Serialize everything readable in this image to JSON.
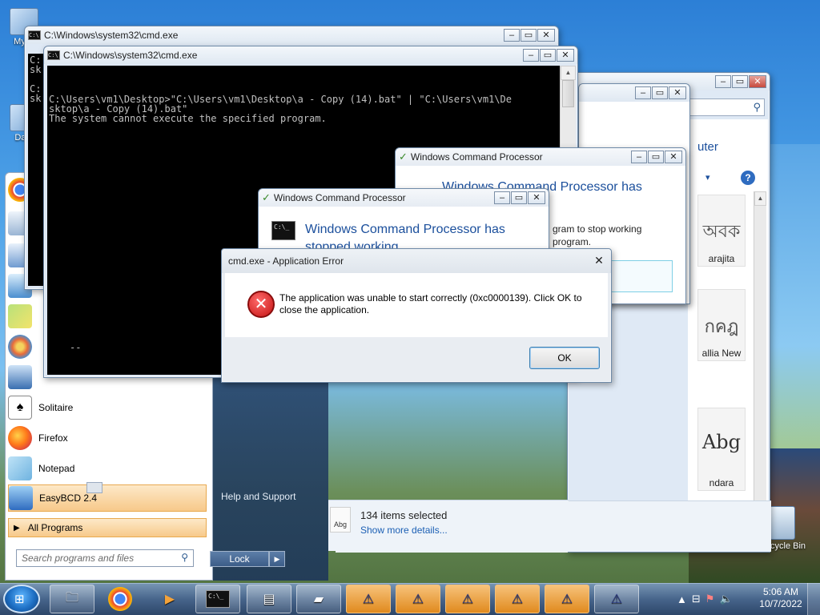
{
  "desktop": {
    "icons": [
      {
        "label": "My C",
        "icon": "computer-icon"
      },
      {
        "label": "Data",
        "icon": "data-icon"
      }
    ],
    "recycle_bin": {
      "label": "Recycle Bin"
    }
  },
  "cmd_back": {
    "title": "C:\\Windows\\system32\\cmd.exe",
    "lines": [
      "C:",
      "sk",
      "",
      "C:",
      "sk"
    ]
  },
  "cmd_front": {
    "title": "C:\\Windows\\system32\\cmd.exe",
    "output": "C:\\Users\\vm1\\Desktop>\"C:\\Users\\vm1\\Desktop\\a - Copy (14).bat\" | \"C:\\Users\\vm1\\De\nsktop\\a - Copy (14).bat\"\nThe system cannot execute the specified program.",
    "cursor": "--"
  },
  "explorer": {
    "partial_title": "uter",
    "status": {
      "selected": "134 items selected",
      "details_link": "Show more details..."
    },
    "tiles": [
      {
        "glyph": "অবক",
        "label": "arajita"
      },
      {
        "glyph": "กคฎ",
        "label": "allia New"
      },
      {
        "glyph": "Abg",
        "label": "ndara"
      }
    ],
    "status_icon_label": "Abg"
  },
  "wcp_back": {
    "title": "Windows Command Processor",
    "heading": "Windows Command Processor has",
    "body_lines": [
      "gram to stop working",
      "program."
    ]
  },
  "wcp_front": {
    "title": "Windows Command Processor",
    "heading": "Windows Command Processor has stopped working"
  },
  "error_dialog": {
    "title": "cmd.exe - Application Error",
    "message": "The application was unable to start correctly (0xc0000139). Click OK to close the application.",
    "ok_label": "OK"
  },
  "start_menu": {
    "items": [
      {
        "label": "",
        "icon": "chrome-icon"
      },
      {
        "label": "",
        "icon": "app-icon"
      },
      {
        "label": "",
        "icon": "app-icon"
      },
      {
        "label": "",
        "icon": "app-icon"
      },
      {
        "label": "",
        "icon": "paint-icon"
      },
      {
        "label": "",
        "icon": "computer-icon"
      },
      {
        "label": "Solitaire",
        "icon": "solitaire-icon"
      },
      {
        "label": "Firefox",
        "icon": "firefox-icon"
      },
      {
        "label": "Notepad",
        "icon": "notepad-icon"
      },
      {
        "label": "EasyBCD 2.4",
        "icon": "easybcd-icon"
      }
    ],
    "all_programs": "All Programs",
    "search_placeholder": "Search programs and files",
    "right_text": "Help and Support",
    "lock": "Lock"
  },
  "taskbar": {
    "clock_time": "5:06 AM",
    "clock_date": "10/7/2022"
  },
  "colors": {
    "accent_title": "#1b4f9c",
    "taskbar_warn": "#e08a1e",
    "error_red": "#d11a1a"
  }
}
